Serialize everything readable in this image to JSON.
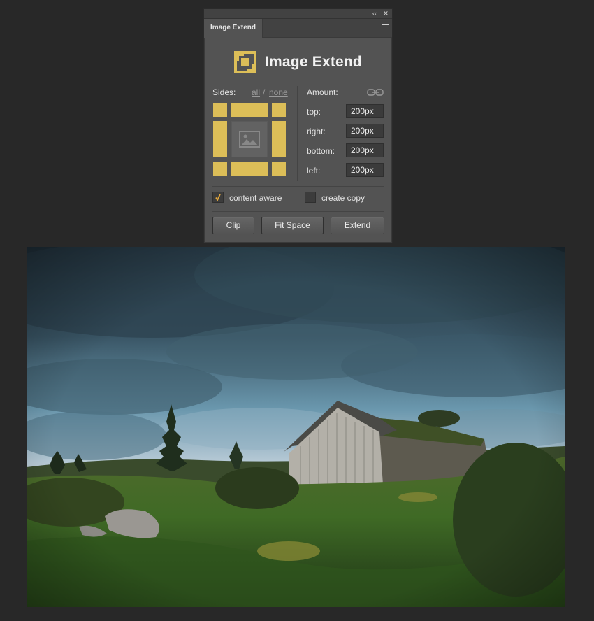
{
  "panel": {
    "tab_label": "Image Extend",
    "title": "Image Extend",
    "collapse_glyph": "‹‹",
    "close_glyph": "✕",
    "colors": {
      "accent": "#dcbe58",
      "panel_bg": "#535353",
      "canvas_bg": "#282828"
    }
  },
  "sides": {
    "label": "Sides:",
    "all_link": "all",
    "separator": "/",
    "none_link": "none"
  },
  "amount": {
    "label": "Amount:",
    "fields": [
      {
        "label": "top:",
        "value": "200px"
      },
      {
        "label": "right:",
        "value": "200px"
      },
      {
        "label": "bottom:",
        "value": "200px"
      },
      {
        "label": "left:",
        "value": "200px"
      }
    ]
  },
  "options": {
    "content_aware": {
      "label": "content aware",
      "checked": true
    },
    "create_copy": {
      "label": "create copy",
      "checked": false
    }
  },
  "buttons": {
    "clip": "Clip",
    "fit_space": "Fit Space",
    "extend": "Extend"
  }
}
